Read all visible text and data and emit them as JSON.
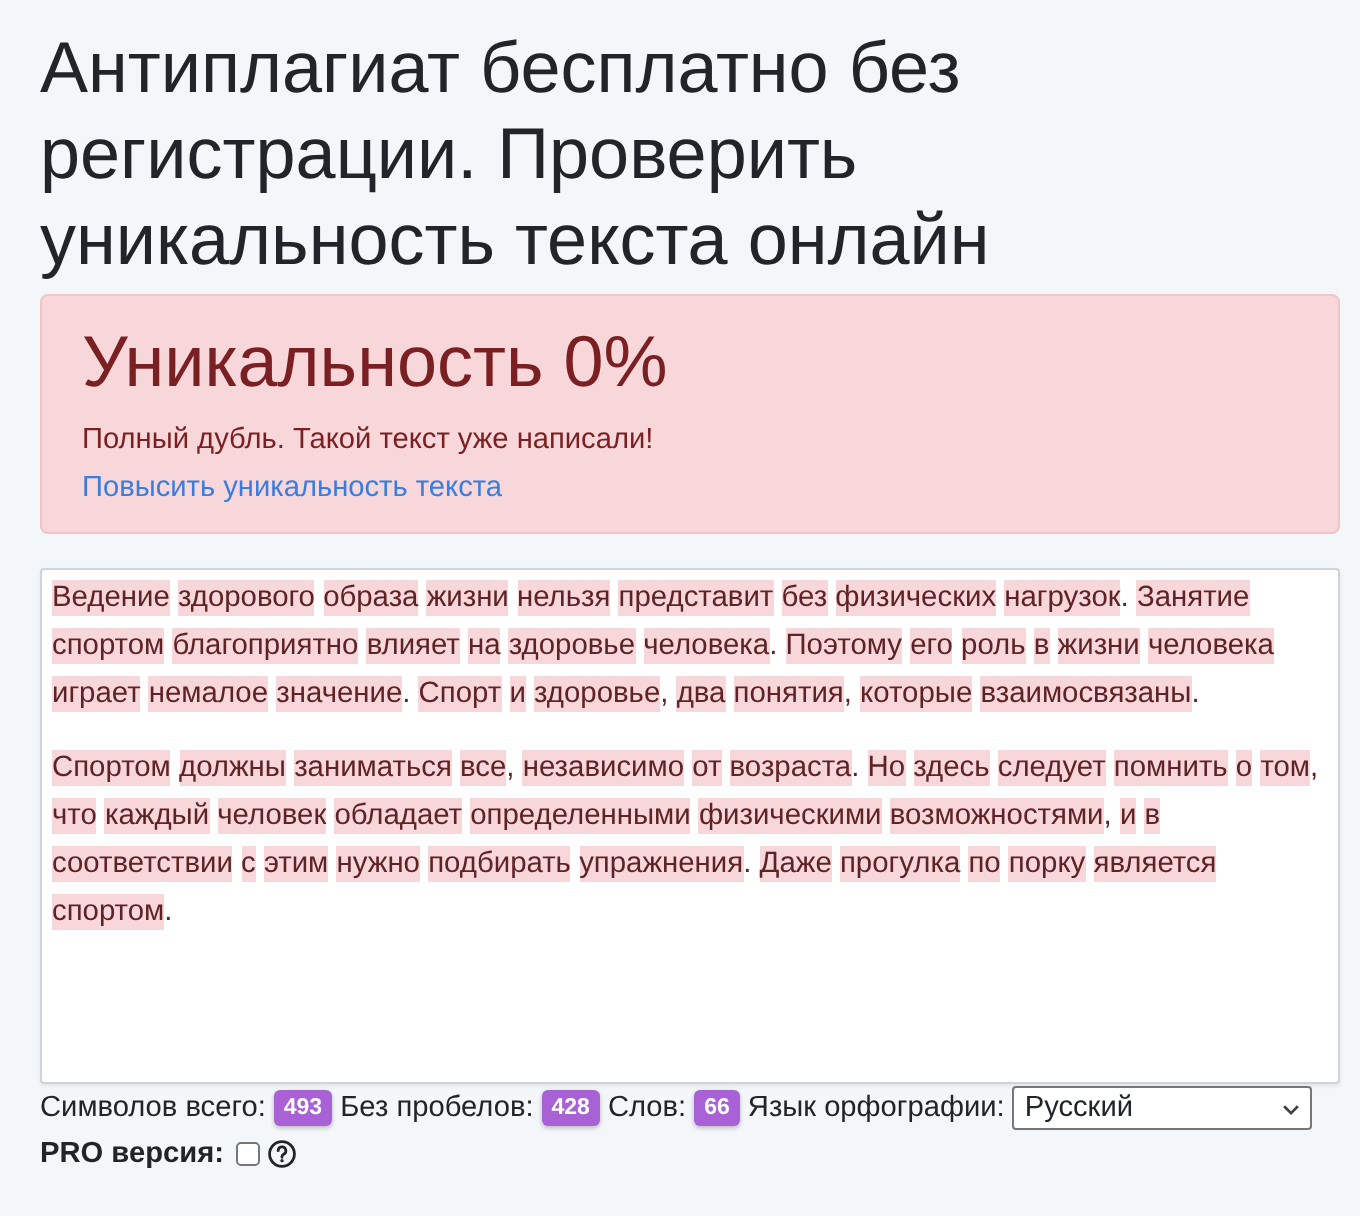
{
  "heading": "Антиплагиат бесплатно без регистрации. Проверить уникальность текста онлайн",
  "result": {
    "kind": "danger",
    "title": "Уникальность 0%",
    "message": "Полный дубль. Такой текст уже написали!",
    "link": "Повысить уникальность текста"
  },
  "editor": {
    "paragraphs": [
      {
        "text": "Ведение здорового образа жизни нельзя представит без физических нагрузок. Занятие спортом благоприятно влияет на здоровье человека. Поэтому его роль в жизни человека играет немалое значение. Спорт и здоровье, два понятия, которые взаимосвязаны.",
        "highlighted": true
      },
      {
        "text": "Спортом должны заниматься все, независимо от возраста. Но здесь следует помнить о том, что каждый человек обладает определенными физическими возможностями, и в соответствии с этим нужно подбирать упражнения. Даже прогулка по порку является спортом.",
        "highlighted": true
      }
    ]
  },
  "stats": [
    {
      "label": "Символов всего:",
      "value": "493"
    },
    {
      "label": "Без пробелов:",
      "value": "428"
    },
    {
      "label": "Слов:",
      "value": "66"
    }
  ],
  "spelling": {
    "label": "Язык орфографии:",
    "value": "Русский"
  },
  "pro": {
    "label": "PRO версия:",
    "checked": false
  }
}
